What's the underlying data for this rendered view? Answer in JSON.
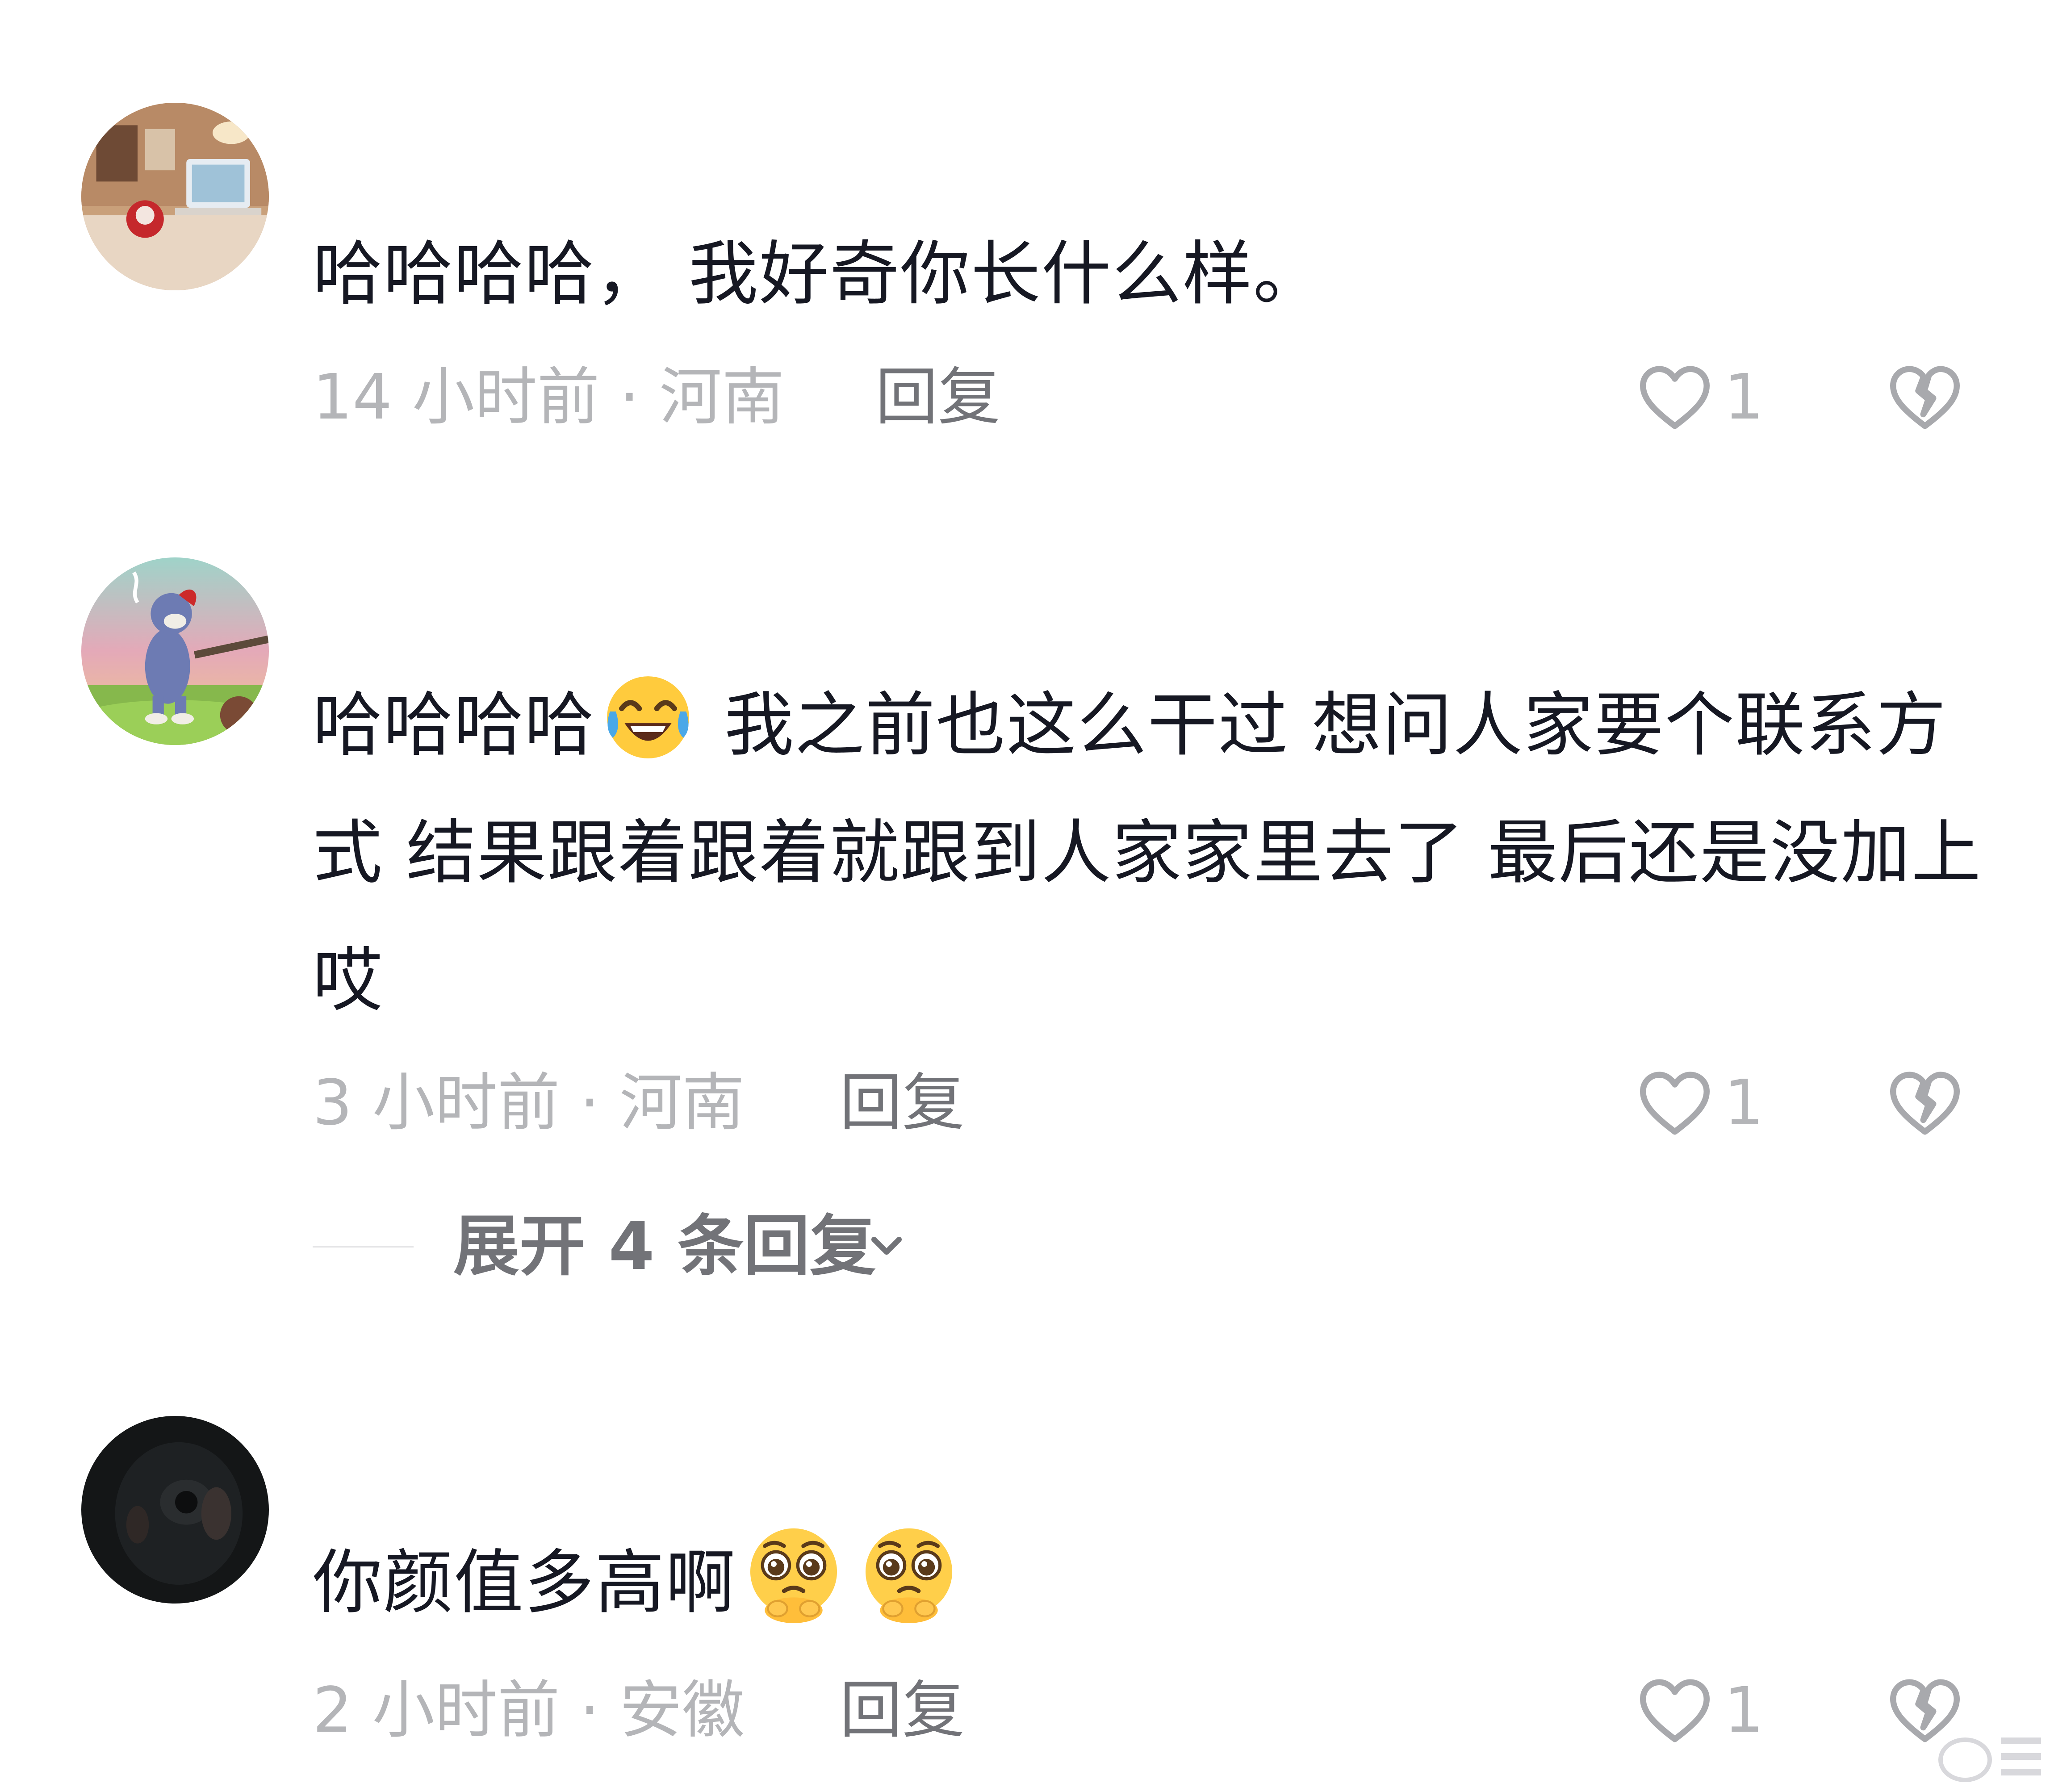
{
  "comments": [
    {
      "text": "哈哈哈哈，  我好奇你长什么样。",
      "time_location": "14 小时前 · 河南",
      "reply_label": "回复",
      "like_count": "1",
      "avatar": "desk-room-photo"
    },
    {
      "text_before_emoji": "哈哈哈哈",
      "emoji": "tears-of-joy-emoji",
      "text_after_emoji": " 我之前也这么干过 想问人家要个联系方式 结果跟着跟着就跟到人家家里去了 最后还是没加上 哎",
      "time_location": "3 小时前 · 河南",
      "reply_label": "回复",
      "like_count": "1",
      "avatar": "cartoon-cat-smoking",
      "expand_label": "展开 4 条回复"
    },
    {
      "text": "你颜值多高啊",
      "emojis": [
        "pleading-emoji",
        "pleading-emoji"
      ],
      "time_location": "2 小时前 · 安徽",
      "reply_label": "回复",
      "like_count": "1",
      "avatar": "dark-portrait-photo"
    }
  ],
  "icons": {
    "like": "heart-outline-icon",
    "dislike": "broken-heart-icon",
    "expand": "chevron-down-icon"
  },
  "colors": {
    "primary_text": "#161823",
    "secondary_text": "#b4b5b8",
    "reply_text": "#727378",
    "icon_gray": "#a8a9ad"
  }
}
